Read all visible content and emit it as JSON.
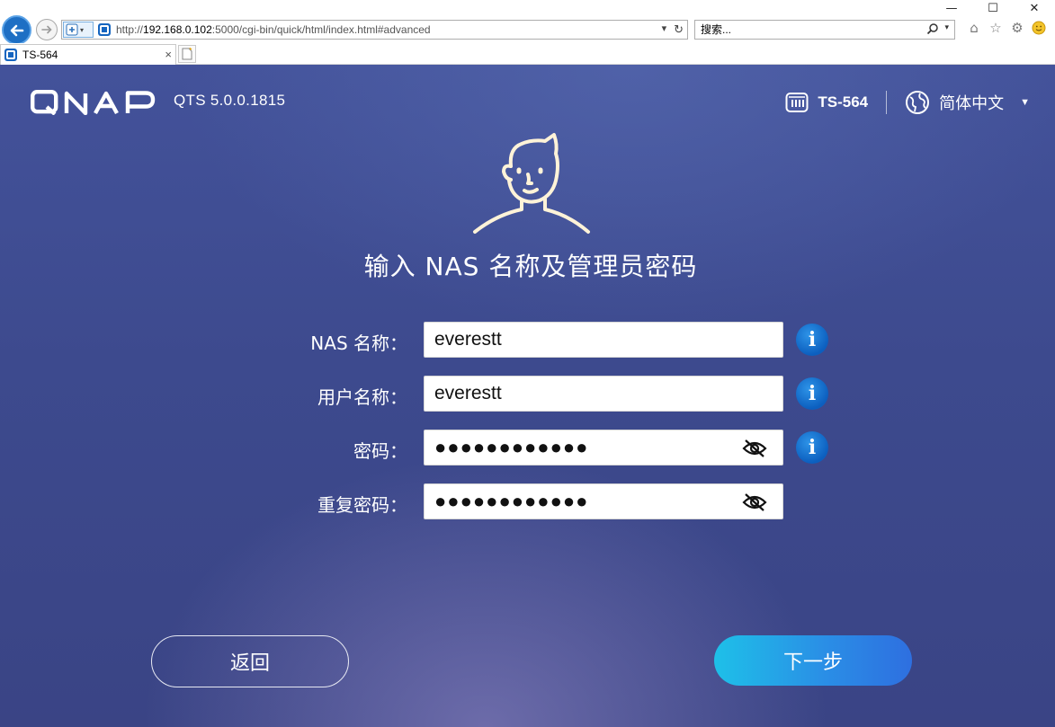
{
  "browser": {
    "window_controls": {
      "minimize": "—",
      "maximize": "☐",
      "close": "✕"
    },
    "address": {
      "scheme": "http://",
      "host": "192.168.0.102",
      "rest": ":5000/cgi-bin/quick/html/index.html#advanced"
    },
    "search": {
      "placeholder": "搜索..."
    },
    "tab": {
      "title": "TS-564",
      "close": "×"
    }
  },
  "app": {
    "brand": "QNAP",
    "version": "QTS 5.0.0.1815",
    "device": "TS-564",
    "language": "简体中文"
  },
  "form": {
    "heading": "输入 NAS 名称及管理员密码",
    "fields": [
      {
        "label": "NAS 名称：",
        "value": "everestt",
        "type": "text"
      },
      {
        "label": "用户名称：",
        "value": "everestt",
        "type": "text"
      },
      {
        "label": "密码：",
        "value": "●●●●●●●●●●●●",
        "type": "password"
      },
      {
        "label": "重复密码：",
        "value": "●●●●●●●●●●●●",
        "type": "password"
      }
    ],
    "info_glyph": "i"
  },
  "actions": {
    "back": "返回",
    "next": "下一步"
  },
  "colors": {
    "page_bg": "#3f4c92",
    "accent_next": "#1ec0e8",
    "info": "#0c5fbf"
  }
}
